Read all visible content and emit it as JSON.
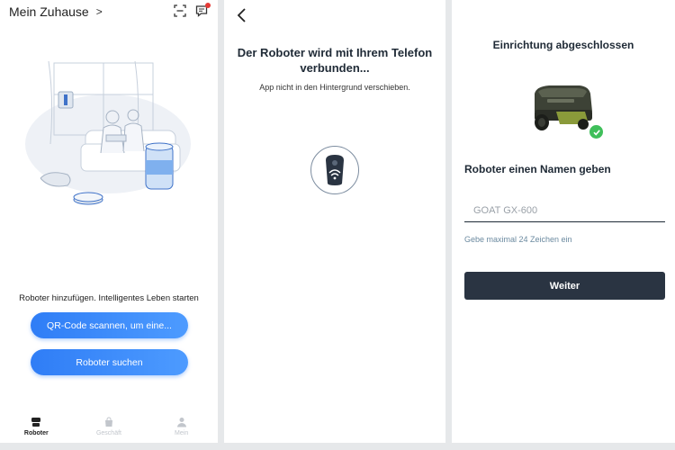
{
  "screen1": {
    "title": "Mein Zuhause",
    "title_chevron": ">",
    "add_hint": "Roboter hinzufügen. Intelligentes Leben starten",
    "qr_button": "QR-Code scannen, um eine...",
    "search_button": "Roboter suchen",
    "nav": [
      {
        "label": "Roboter",
        "icon": "robot-icon",
        "active": true
      },
      {
        "label": "Geschäft",
        "icon": "shopping-bag-icon",
        "active": false
      },
      {
        "label": "Mein",
        "icon": "person-icon",
        "active": false
      }
    ],
    "notification_dot_color": "#e53935",
    "accent": "#2f7df6"
  },
  "screen2": {
    "title": "Der Roboter wird mit Ihrem Telefon verbunden...",
    "subtitle": "App nicht in den Hintergrund verschieben.",
    "icon": "wifi-remote-icon"
  },
  "screen3": {
    "title": "Einrichtung abgeschlossen",
    "name_heading": "Roboter einen Namen geben",
    "name_placeholder": "GOAT GX-600",
    "hint": "Gebe maximal 24 Zeichen ein",
    "continue_button": "Weiter",
    "button_color": "#2a3442",
    "success_color": "#3fbf5a"
  }
}
